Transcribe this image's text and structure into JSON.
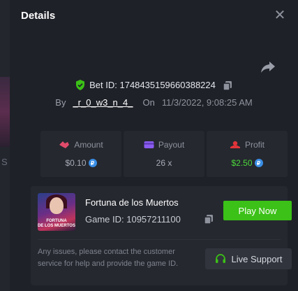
{
  "modal": {
    "title": "Details",
    "close_icon": "close-icon",
    "share_icon": "share-icon"
  },
  "bet": {
    "label": "Bet ID: 1748435159660388224",
    "by_label": "By",
    "user": "_r_0_w3_n_4_",
    "on_label": "On",
    "datetime": "11/3/2022, 9:08:25 AM"
  },
  "stats": [
    {
      "icon": "amount-icon",
      "label": "Amount",
      "value": "$0.10",
      "coin": true
    },
    {
      "icon": "payout-icon",
      "label": "Payout",
      "value": "26 x",
      "coin": false
    },
    {
      "icon": "profit-icon",
      "label": "Profit",
      "value": "$2.50",
      "coin": true
    }
  ],
  "game": {
    "name": "Fortuna de los Muertos",
    "id_label": "Game ID: 10957211100",
    "thumb_text_line1": "FORTUNA",
    "thumb_text_line2": "DE LOS MUERTOS",
    "play_label": "Play Now"
  },
  "support": {
    "notice": "Any issues, please contact the customer service for help and provide the game ID.",
    "button_label": "Live Support"
  },
  "colors": {
    "accent_green": "#3bc117",
    "profit_green": "#4cd93a",
    "coin_blue": "#3a8ee6"
  }
}
